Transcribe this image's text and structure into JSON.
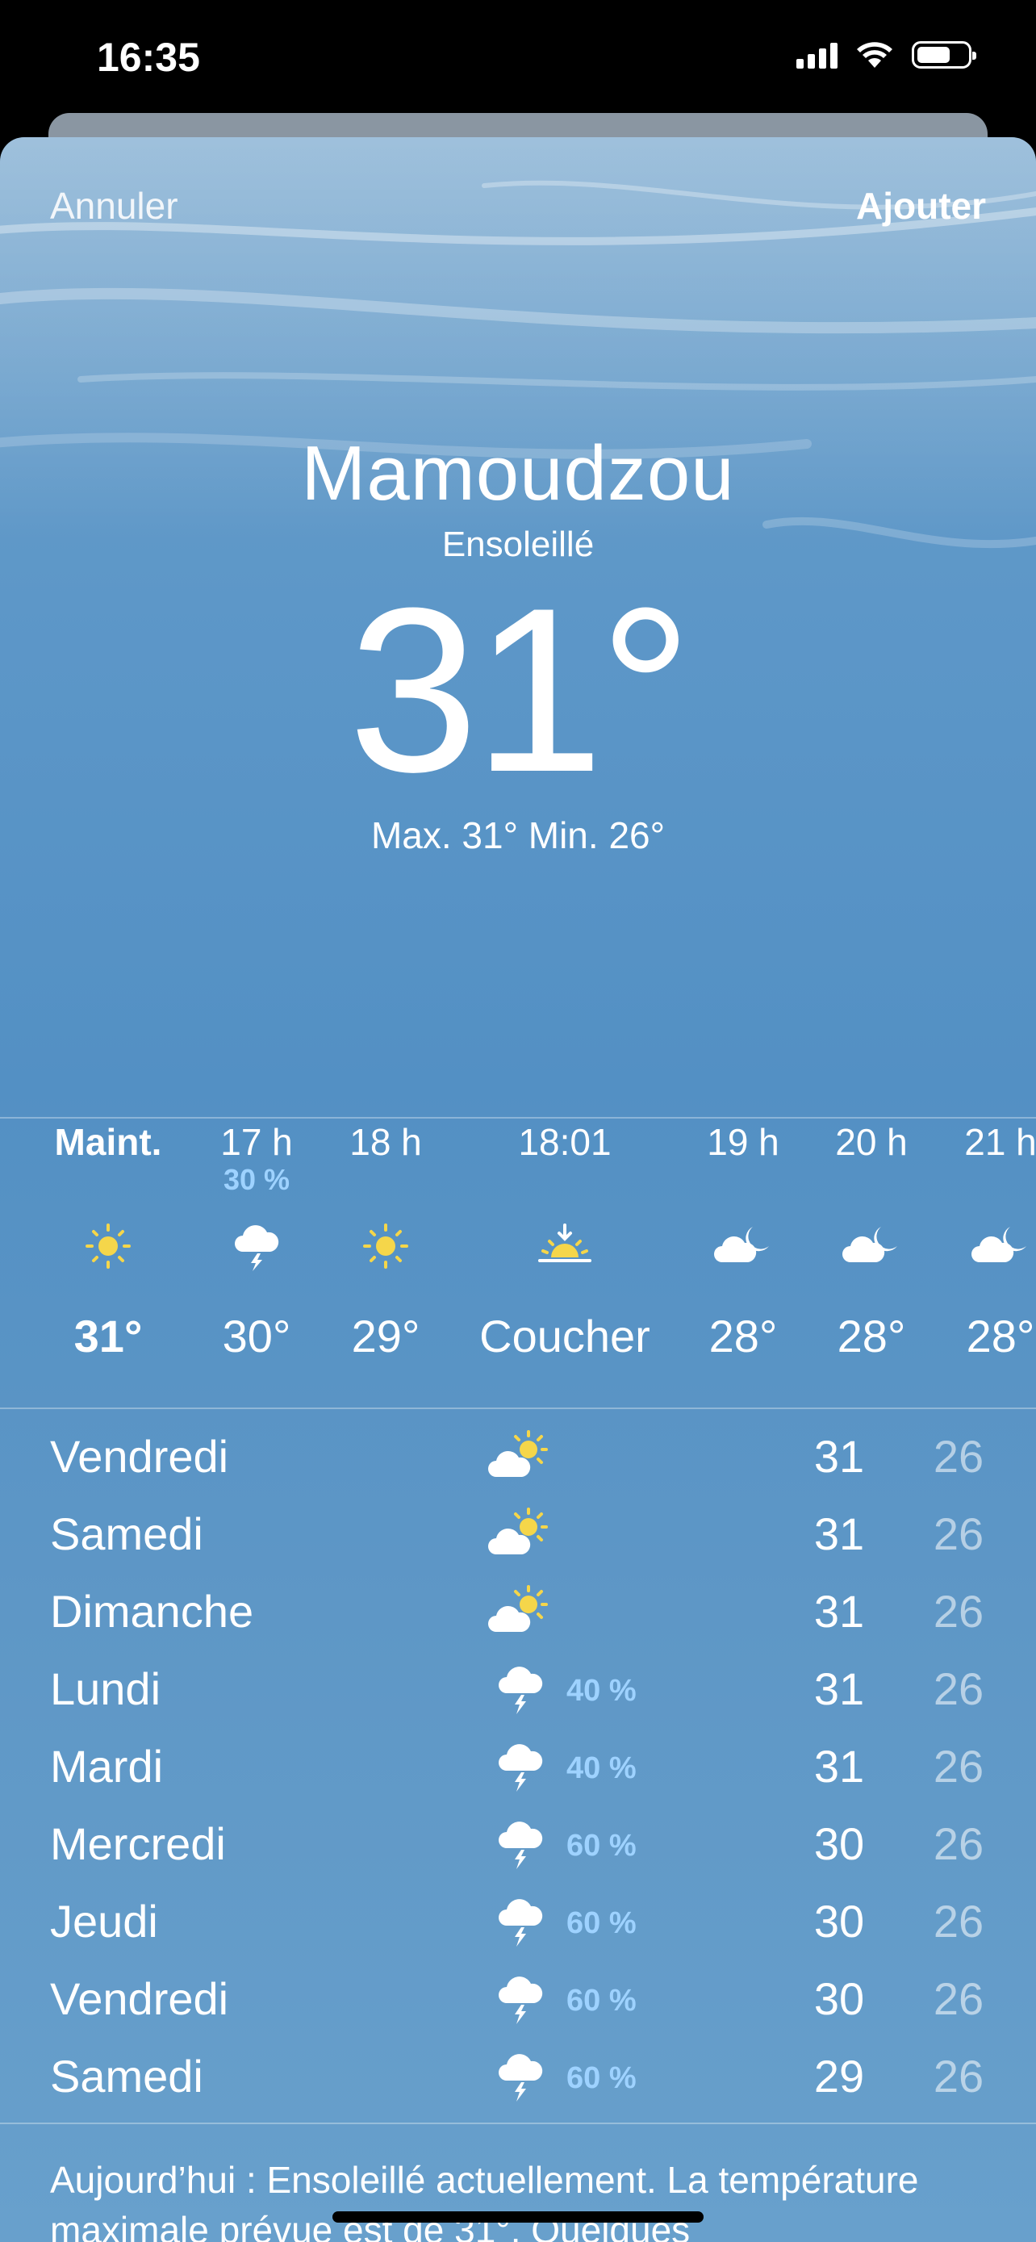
{
  "status_bar": {
    "time": "16:35"
  },
  "nav": {
    "cancel": "Annuler",
    "add": "Ajouter"
  },
  "current": {
    "city": "Mamoudzou",
    "condition": "Ensoleillé",
    "temperature": "31°",
    "high_low": "Max. 31° Min. 26°"
  },
  "hourly": [
    {
      "time": "Maint.",
      "pop": "",
      "icon": "sun-icon",
      "temp": "31°"
    },
    {
      "time": "17 h",
      "pop": "30 %",
      "icon": "thunder-cloud-icon",
      "temp": "30°"
    },
    {
      "time": "18 h",
      "pop": "",
      "icon": "sun-icon",
      "temp": "29°"
    },
    {
      "time": "18:01",
      "pop": "",
      "icon": "sunset-icon",
      "temp": "Coucher"
    },
    {
      "time": "19 h",
      "pop": "",
      "icon": "cloud-moon-icon",
      "temp": "28°"
    },
    {
      "time": "20 h",
      "pop": "",
      "icon": "cloud-moon-icon",
      "temp": "28°"
    },
    {
      "time": "21 h",
      "pop": "",
      "icon": "cloud-moon-icon",
      "temp": "28°"
    }
  ],
  "daily": [
    {
      "day": "Vendredi",
      "icon": "partly-sunny-icon",
      "pop": "",
      "high": "31",
      "low": "26"
    },
    {
      "day": "Samedi",
      "icon": "partly-sunny-icon",
      "pop": "",
      "high": "31",
      "low": "26"
    },
    {
      "day": "Dimanche",
      "icon": "partly-sunny-icon",
      "pop": "",
      "high": "31",
      "low": "26"
    },
    {
      "day": "Lundi",
      "icon": "thunder-cloud-icon",
      "pop": "40 %",
      "high": "31",
      "low": "26"
    },
    {
      "day": "Mardi",
      "icon": "thunder-cloud-icon",
      "pop": "40 %",
      "high": "31",
      "low": "26"
    },
    {
      "day": "Mercredi",
      "icon": "thunder-cloud-icon",
      "pop": "60 %",
      "high": "30",
      "low": "26"
    },
    {
      "day": "Jeudi",
      "icon": "thunder-cloud-icon",
      "pop": "60 %",
      "high": "30",
      "low": "26"
    },
    {
      "day": "Vendredi",
      "icon": "thunder-cloud-icon",
      "pop": "60 %",
      "high": "30",
      "low": "26"
    },
    {
      "day": "Samedi",
      "icon": "thunder-cloud-icon",
      "pop": "60 %",
      "high": "29",
      "low": "26"
    }
  ],
  "summary": "Aujourd’hui : Ensoleillé actuellement. La température maximale prévue est de 31°. Quelques",
  "colors": {
    "precip": "#9ed2ff",
    "sun": "#f5d64a",
    "sky": "#5390c4"
  }
}
